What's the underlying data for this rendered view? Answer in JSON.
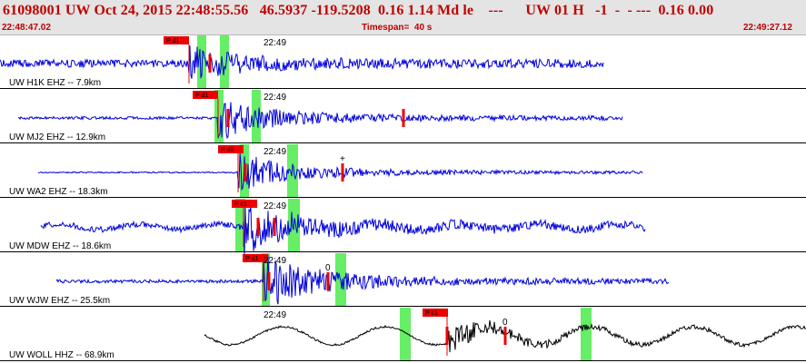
{
  "header": {
    "title": "61098001 UW Oct 24, 2015 22:48:55.56   46.5937 -119.5208  0.16 1.14 Md le    ---      UW 01 H   -1  -  - ---  0.16 0.00",
    "start_time": "22:48:47.02",
    "timespan": "Timespan=  40 s",
    "end_time": "22:49:27.12"
  },
  "colors": {
    "header_text": "#c00000",
    "trace": "#0000dd",
    "trace_alt": "#000000",
    "pick": "#ee0000",
    "window": "#66ee66"
  },
  "traces": [
    {
      "label": "UW H1K EHZ -- 7.9km",
      "time_label": "22:49",
      "pick": "P d1",
      "extra_mark": "",
      "color": "blue"
    },
    {
      "label": "UW MJ2 EHZ -- 12.9km",
      "time_label": "22:49",
      "pick": "P d1",
      "extra_mark": "",
      "color": "blue"
    },
    {
      "label": "UW WA2 EHZ -- 18.3km",
      "time_label": "22:49",
      "pick": "P d0",
      "extra_mark": "+",
      "color": "blue"
    },
    {
      "label": "UW MDW EHZ -- 18.6km",
      "time_label": "22:49",
      "pick": "P c1",
      "extra_mark": "",
      "color": "blue"
    },
    {
      "label": "UW WJW EHZ -- 25.5km",
      "time_label": "22:49",
      "pick": "P d1",
      "extra_mark": "0",
      "color": "blue"
    },
    {
      "label": "UW WOLL HHZ -- 68.9km",
      "time_label": "22:49",
      "pick": "P c1",
      "extra_mark": "0",
      "color": "black"
    }
  ]
}
